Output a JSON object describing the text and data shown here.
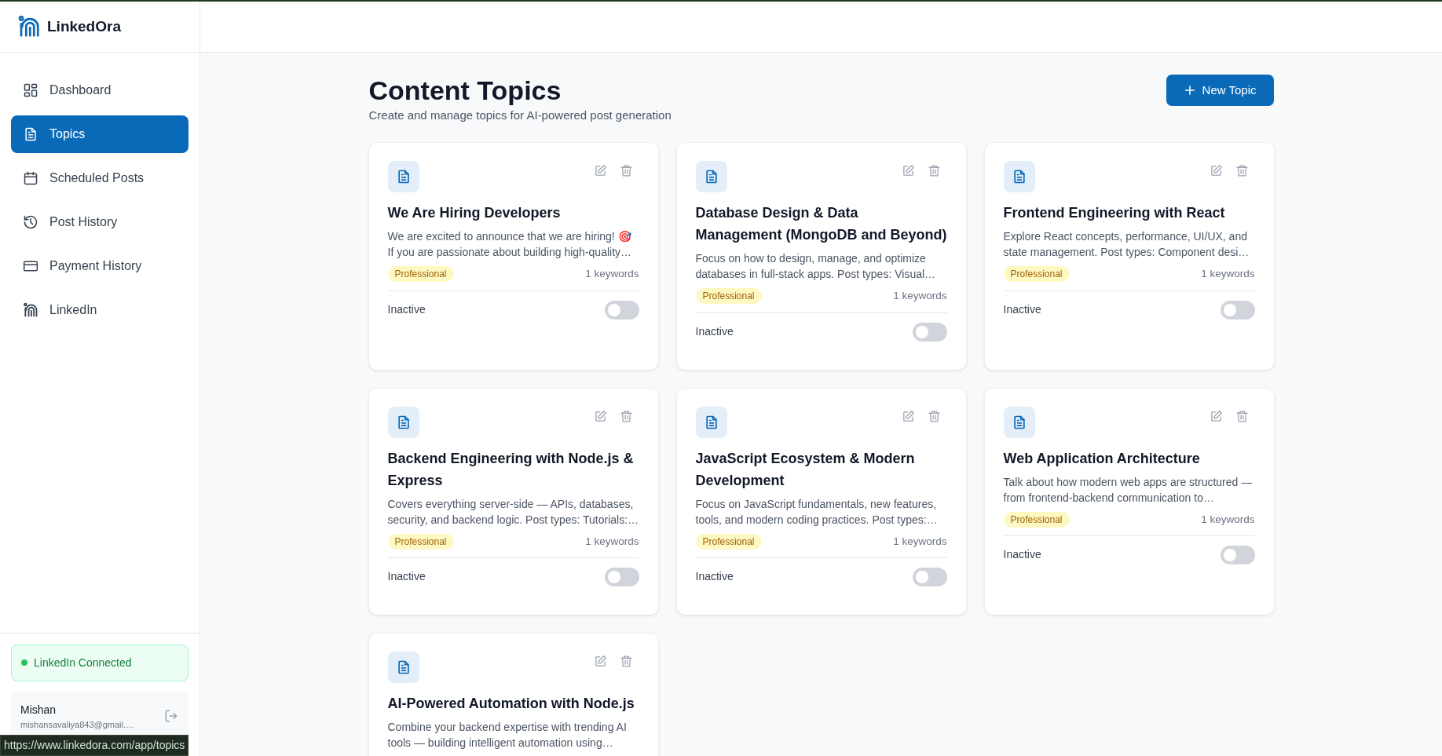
{
  "brand": {
    "name": "LinkedOra"
  },
  "sidebar": {
    "items": [
      {
        "label": "Dashboard",
        "kind": "grid",
        "selected": false
      },
      {
        "label": "Topics",
        "kind": "document",
        "selected": true
      },
      {
        "label": "Scheduled Posts",
        "kind": "calendar",
        "selected": false
      },
      {
        "label": "Post History",
        "kind": "history",
        "selected": false
      },
      {
        "label": "Payment History",
        "kind": "card",
        "selected": false
      },
      {
        "label": "LinkedIn",
        "kind": "brand",
        "selected": false
      }
    ],
    "connection": {
      "label": "LinkedIn Connected",
      "color": "#22c55e"
    },
    "user": {
      "name": "Mishan",
      "email": "mishansavaliya843@gmail.…"
    }
  },
  "page": {
    "title": "Content Topics",
    "subtitle": "Create and manage topics for AI-powered post generation",
    "new_button": "New Topic"
  },
  "topics": [
    {
      "title": "We Are Hiring Developers",
      "description": "We are excited to announce that we are hiring! 🎯 If you are passionate about building high-quality…",
      "tone": "Professional",
      "keywords": "1 keywords",
      "status": "Inactive",
      "active": false
    },
    {
      "title": "Database Design & Data Management (MongoDB and Beyond)",
      "description": "Focus on how to design, manage, and optimize databases in full-stack apps. Post types: Visual…",
      "tone": "Professional",
      "keywords": "1 keywords",
      "status": "Inactive",
      "active": false
    },
    {
      "title": "Frontend Engineering with React",
      "description": "Explore React concepts, performance, UI/UX, and state management. Post types: Component desi…",
      "tone": "Professional",
      "keywords": "1 keywords",
      "status": "Inactive",
      "active": false
    },
    {
      "title": "Backend Engineering with Node.js & Express",
      "description": "Covers everything server-side — APIs, databases, security, and backend logic. Post types: Tutorials:…",
      "tone": "Professional",
      "keywords": "1 keywords",
      "status": "Inactive",
      "active": false
    },
    {
      "title": "JavaScript Ecosystem & Modern Development",
      "description": "Focus on JavaScript fundamentals, new features, tools, and modern coding practices. Post types:…",
      "tone": "Professional",
      "keywords": "1 keywords",
      "status": "Inactive",
      "active": false
    },
    {
      "title": "Web Application Architecture",
      "description": "Talk about how modern web apps are structured — from frontend-backend communication to…",
      "tone": "Professional",
      "keywords": "1 keywords",
      "status": "Inactive",
      "active": false
    },
    {
      "title": "AI-Powered Automation with Node.js",
      "description": "Combine your backend expertise with trending AI tools — building intelligent automation using…"
    }
  ],
  "status_bar": {
    "url": "https://www.linkedora.com/app/topics"
  }
}
